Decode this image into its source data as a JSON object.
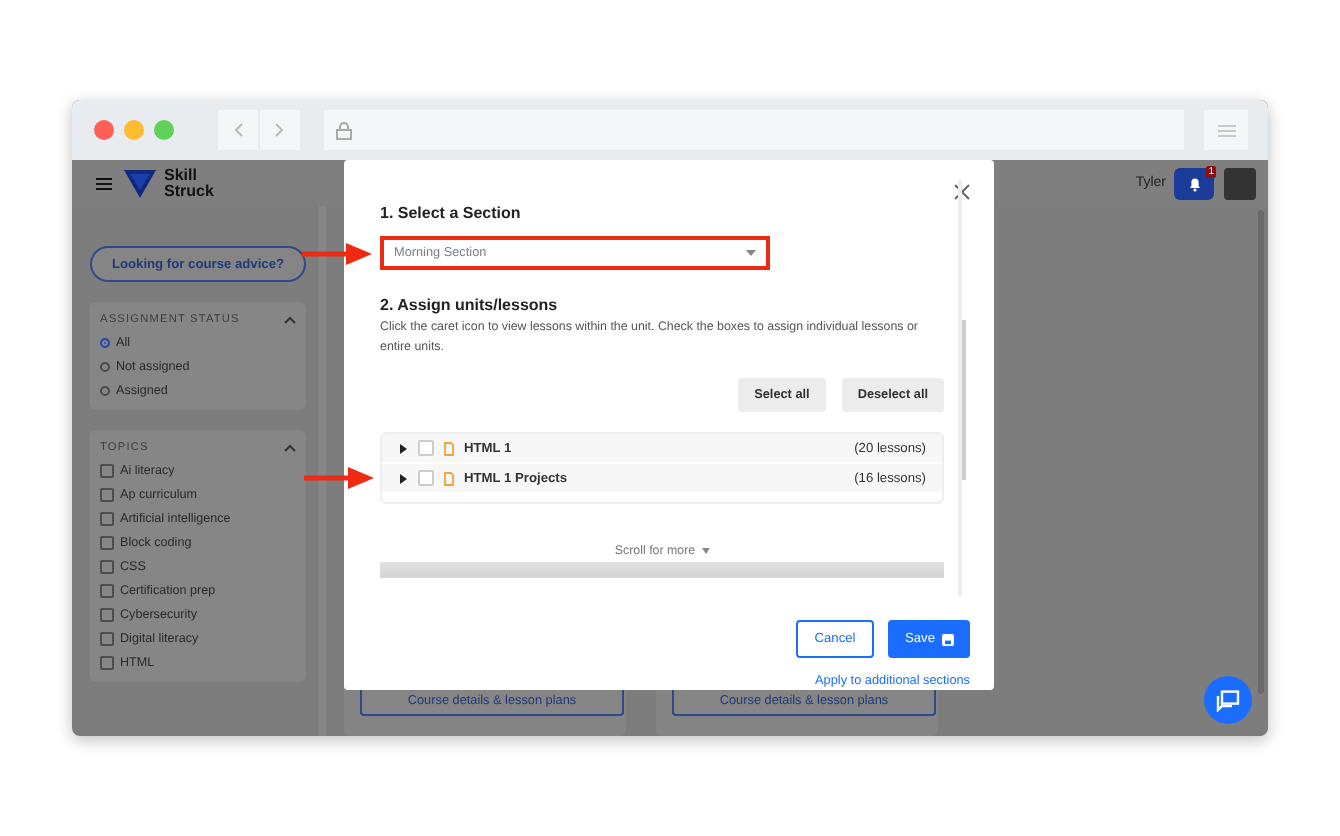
{
  "app_header": {
    "brand_lines": [
      "Skill",
      "Struck"
    ],
    "user_name": "Tyler",
    "notification_count": "1"
  },
  "sidebar": {
    "advice_button": "Looking for course advice?",
    "filters": [
      {
        "title": "ASSIGNMENT STATUS",
        "expanded": true,
        "kind": "radio",
        "options": [
          {
            "label": "All",
            "selected": true
          },
          {
            "label": "Not assigned",
            "selected": false
          },
          {
            "label": "Assigned",
            "selected": false
          }
        ]
      },
      {
        "title": "TOPICS",
        "expanded": true,
        "kind": "checkbox",
        "options": [
          {
            "label": "Ai literacy",
            "checked": false
          },
          {
            "label": "Ap curriculum",
            "checked": false
          },
          {
            "label": "Artificial intelligence",
            "checked": false
          },
          {
            "label": "Block coding",
            "checked": false
          },
          {
            "label": "CSS",
            "checked": false
          },
          {
            "label": "Certification prep",
            "checked": false
          },
          {
            "label": "Cybersecurity",
            "checked": false
          },
          {
            "label": "Digital literacy",
            "checked": false
          },
          {
            "label": "HTML",
            "checked": false
          }
        ]
      }
    ]
  },
  "cards": [
    {
      "button": "Course details & lesson plans"
    },
    {
      "button": "Course details & lesson plans"
    }
  ],
  "modal": {
    "section_heading": "1. Select a Section",
    "section_select": {
      "value": "Morning Section",
      "highlighted": true,
      "arrow": true
    },
    "units_heading": "2. Assign units/lessons",
    "units_hint": "Click the caret icon to view lessons within the unit. Check the boxes to assign individual lessons or entire units.",
    "select_all": "Select all",
    "deselect_all": "Deselect all",
    "units": [
      {
        "name": "HTML 1",
        "count": "(20 lessons)",
        "expanded": false,
        "checked": false,
        "arrow": false
      },
      {
        "name": "HTML 1 Projects",
        "count": "(16 lessons)",
        "expanded": false,
        "checked": false,
        "arrow": true
      }
    ],
    "scroll_hint": "Scroll for more",
    "cancel": "Cancel",
    "save": "Save",
    "apply_link": "Apply to additional sections"
  }
}
